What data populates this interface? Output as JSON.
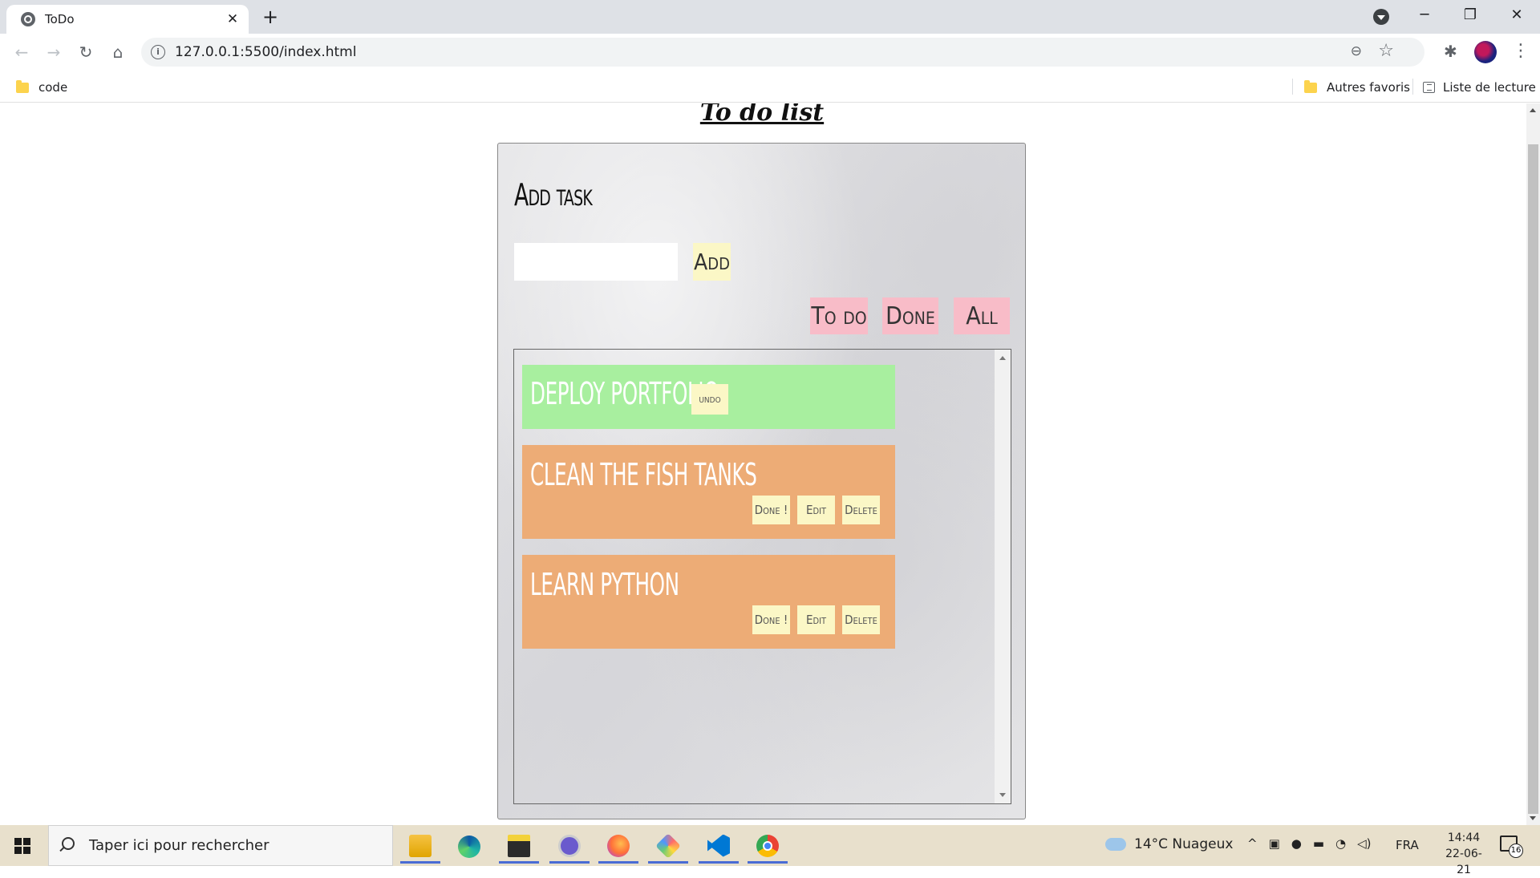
{
  "browser": {
    "tab_title": "ToDo",
    "tab_close": "✕",
    "new_tab": "+",
    "url": "127.0.0.1:5500/index.html",
    "window_min": "─",
    "window_max": "❐",
    "window_close": "✕",
    "nav": {
      "back": "←",
      "forward": "→",
      "reload": "↻",
      "home": "⌂"
    },
    "bookmarks": [
      {
        "label": "code",
        "icon": "folder-icon"
      }
    ],
    "other_bookmarks": "Autres favoris",
    "reading_list": "Liste de lecture"
  },
  "page": {
    "title": "To do list",
    "add_task_heading": "Add task",
    "task_input_value": "",
    "add_button": "Add",
    "filters": [
      "To do",
      "Done",
      "All"
    ],
    "tasks": [
      {
        "name": "deploy portfolio",
        "status": "done",
        "actions": [
          "undo"
        ]
      },
      {
        "name": "clean the fish tanks",
        "status": "todo",
        "actions": [
          "Done !",
          "Edit",
          "Delete"
        ]
      },
      {
        "name": "learn python",
        "status": "todo",
        "actions": [
          "Done !",
          "Edit",
          "Delete"
        ]
      }
    ],
    "colors": {
      "done_task": "#a8ef9f",
      "todo_task": "#edac76",
      "filter_button": "#f8bcc8",
      "small_button": "#fbf7c6"
    }
  },
  "taskbar": {
    "search_placeholder": "Taper ici pour rechercher",
    "apps": [
      "file-explorer",
      "edge",
      "sticky-notes",
      "chat",
      "firefox",
      "git-app",
      "vscode",
      "chrome"
    ],
    "weather": "14°C  Nuageux",
    "language": "FRA",
    "time": "14:44",
    "date": "22-06-21",
    "notification_count": "16"
  }
}
